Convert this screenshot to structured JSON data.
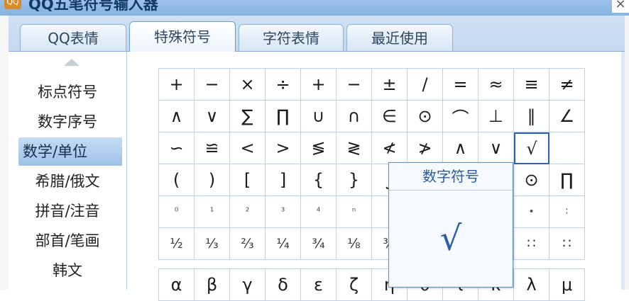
{
  "window": {
    "title": "QQ五笔符号输入器",
    "close_label": "×",
    "icon": "app-logo-icon"
  },
  "tabs": [
    {
      "label": "QQ表情",
      "active": false
    },
    {
      "label": "特殊符号",
      "active": true
    },
    {
      "label": "字符表情",
      "active": false
    },
    {
      "label": "最近使用",
      "active": false
    }
  ],
  "categories": [
    {
      "label": "标点符号",
      "active": false
    },
    {
      "label": "数字序号",
      "active": false
    },
    {
      "label": "数学/单位",
      "active": true
    },
    {
      "label": "希腊/俄文",
      "active": false
    },
    {
      "label": "拼音/注音",
      "active": false
    },
    {
      "label": "部首/笔画",
      "active": false
    },
    {
      "label": "韩文",
      "active": false
    }
  ],
  "symbol_rows": [
    [
      "+",
      "−",
      "×",
      "÷",
      "+",
      "−",
      "±",
      "∕",
      "=",
      "≈",
      "≡",
      "≠"
    ],
    [
      "∧",
      "∨",
      "∑",
      "∏",
      "∪",
      "∩",
      "∈",
      "⊙",
      "⌒",
      "⊥",
      "∥",
      "∠"
    ],
    [
      "∽",
      "≌",
      "<",
      ">",
      "≶",
      "≷",
      "≮",
      "≯",
      "∧",
      "∨",
      "√",
      ""
    ],
    [
      "(",
      ")",
      "[",
      "]",
      "{",
      "}",
      "∫",
      "",
      "",
      "",
      "⊙",
      "∏"
    ],
    [
      "⁰",
      "¹",
      "²",
      "³",
      "⁴",
      "ⁿ",
      "",
      "",
      "",
      "",
      "•",
      "∶"
    ],
    [
      "½",
      "⅓",
      "⅔",
      "¼",
      "¾",
      "⅛",
      "⅜",
      "",
      "",
      "",
      "∷",
      "∷"
    ]
  ],
  "greek_row": [
    "α",
    "β",
    "γ",
    "δ",
    "ε",
    "ζ",
    "η",
    "θ",
    "ι",
    "κ",
    "λ",
    "μ"
  ],
  "selected_symbol": {
    "row": 2,
    "col": 10
  },
  "tooltip": {
    "title": "数字符号",
    "preview": "√"
  }
}
